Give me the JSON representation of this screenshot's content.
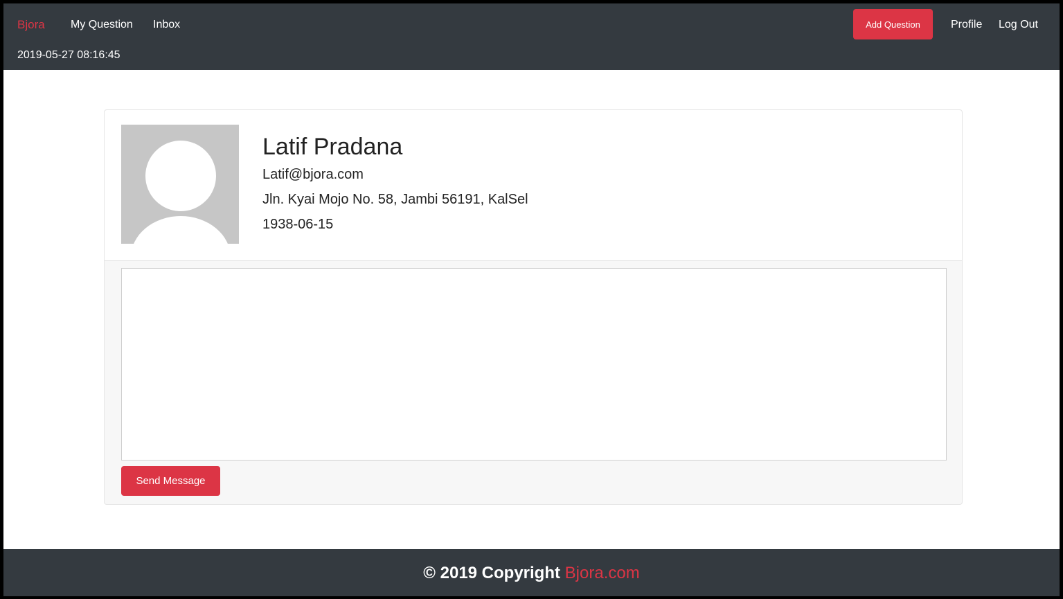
{
  "navbar": {
    "brand": "Bjora",
    "links": [
      "My Question",
      "Inbox"
    ],
    "datetime": "2019-05-27 08:16:45",
    "add_question_label": "Add Question",
    "profile_label": "Profile",
    "logout_label": "Log Out"
  },
  "profile": {
    "name": "Latif Pradana",
    "email": "Latif@bjora.com",
    "address": "Jln. Kyai Mojo No. 58, Jambi 56191, KalSel",
    "birthdate": "1938-06-15",
    "avatar_icon": "default-user-avatar-icon"
  },
  "message": {
    "value": "",
    "send_label": "Send Message"
  },
  "footer": {
    "text": "© 2019 Copyright",
    "brand": "Bjora.com"
  },
  "colors": {
    "navbar_bg": "#343a40",
    "accent": "#dc3545",
    "card_bg": "#f7f7f7"
  }
}
